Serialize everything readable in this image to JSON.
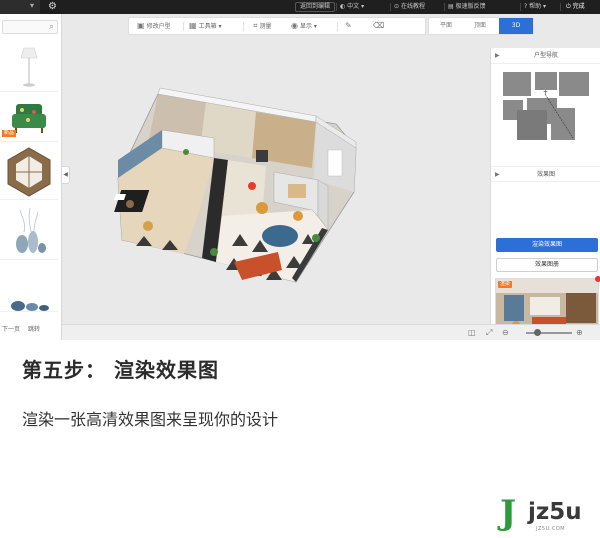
{
  "topbar": {
    "back_label": "返回到编辑",
    "language": "中文",
    "online_tutorial": "在线教程",
    "feedback": "极速版反馈",
    "help": "帮助",
    "done": "完成"
  },
  "toolbar": {
    "items": [
      {
        "label": "修改户型",
        "icon": "floorplan-edit-icon"
      },
      {
        "label": "工具箱",
        "icon": "toolbox-icon"
      },
      {
        "label": "测量",
        "icon": "measure-icon"
      },
      {
        "label": "显示",
        "icon": "eye-icon"
      },
      {
        "label": "",
        "icon": "eraser-icon"
      }
    ]
  },
  "view_tabs": {
    "items": [
      "平面",
      "顶面",
      "3D"
    ],
    "active": "3D"
  },
  "left_panel": {
    "footer_prev": "下一页",
    "footer_jump": "跳转",
    "badge": "新品"
  },
  "right_panel": {
    "floor_nav_title": "户型导航",
    "render_title": "效果图",
    "render_button": "渲染效果图",
    "gallery_button": "效果图册",
    "thumb_badge": "渲染"
  },
  "caption": {
    "title": "第五步： 渲染效果图",
    "description": "渲染一张高清效果图来呈现你的设计"
  },
  "logo": {
    "letter": "J",
    "text": "jz5u",
    "sub": "JZ5U.COM"
  },
  "colors": {
    "accent": "#2c6fd6",
    "brand_green": "#2e9a3a",
    "badge_orange": "#f07a25"
  }
}
